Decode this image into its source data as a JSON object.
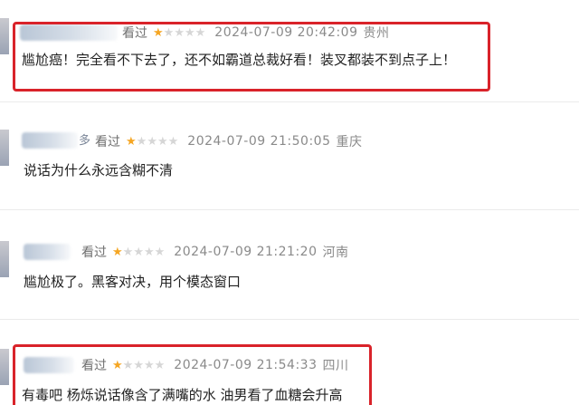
{
  "reviews": [
    {
      "name_tail": "",
      "watched": "看过",
      "stars_filled": 1,
      "stars_total": 5,
      "timestamp": "2024-07-09 20:42:09",
      "location": "贵州",
      "comment": "尴尬癌！完全看不下去了，还不如霸道总裁好看！装叉都装不到点子上！",
      "highlighted": true
    },
    {
      "name_tail": "多",
      "watched": "看过",
      "stars_filled": 1,
      "stars_total": 5,
      "timestamp": "2024-07-09 21:50:05",
      "location": "重庆",
      "comment": "说话为什么永远含糊不清",
      "highlighted": false
    },
    {
      "name_tail": "",
      "watched": "看过",
      "stars_filled": 1,
      "stars_total": 5,
      "timestamp": "2024-07-09 21:21:20",
      "location": "河南",
      "comment": "尴尬极了。黑客对决，用个模态窗口",
      "highlighted": false
    },
    {
      "name_tail": "",
      "watched": "看过",
      "stars_filled": 1,
      "stars_total": 5,
      "timestamp": "2024-07-09 21:54:33",
      "location": "四川",
      "comment": "有毒吧 杨烁说话像含了满嘴的水 油男看了血糖会升高",
      "highlighted": true
    }
  ],
  "colors": {
    "highlight": "#d9232a",
    "star_on": "#f5a623",
    "star_off": "#d6d6d6"
  }
}
